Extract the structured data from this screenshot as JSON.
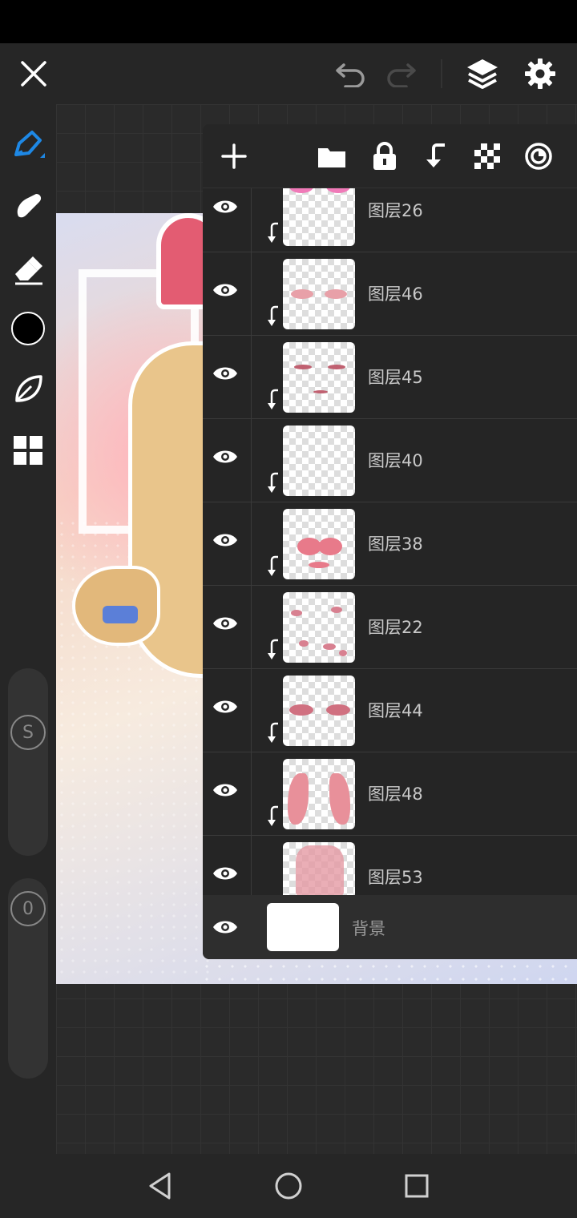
{
  "app": {
    "colors": {
      "accent": "#1e88e5",
      "toolbar": "#262626",
      "panel": "#262626",
      "icon": "#ffffff",
      "muted": "#888888"
    }
  },
  "topbar": {
    "icons": [
      "close-icon",
      "undo-icon",
      "redo-icon",
      "layers-icon",
      "settings-icon"
    ]
  },
  "sidebar": {
    "tools": [
      "pen-icon",
      "smudge-icon",
      "eraser-icon",
      "color-swatch",
      "leaf-icon",
      "grid-icon"
    ],
    "current_color": "#000000",
    "size_slider_label": "S",
    "opacity_slider_label": "0"
  },
  "layers_panel": {
    "toolbar_icons": [
      "add-layer-icon",
      "folder-icon",
      "lock-icon",
      "clip-icon",
      "transparency-icon",
      "blend-icon"
    ],
    "layers": [
      {
        "name": "图层26",
        "visible": true,
        "clipped": true
      },
      {
        "name": "图层46",
        "visible": true,
        "clipped": true
      },
      {
        "name": "图层45",
        "visible": true,
        "clipped": true
      },
      {
        "name": "图层40",
        "visible": true,
        "clipped": true
      },
      {
        "name": "图层38",
        "visible": true,
        "clipped": true
      },
      {
        "name": "图层22",
        "visible": true,
        "clipped": true
      },
      {
        "name": "图层44",
        "visible": true,
        "clipped": true
      },
      {
        "name": "图层48",
        "visible": true,
        "clipped": true
      },
      {
        "name": "图层53",
        "visible": true,
        "clipped": false
      }
    ],
    "background": {
      "name": "背景",
      "visible": true,
      "color": "#ffffff"
    }
  },
  "navbar": {
    "icons": [
      "back-icon",
      "home-icon",
      "recents-icon"
    ]
  }
}
